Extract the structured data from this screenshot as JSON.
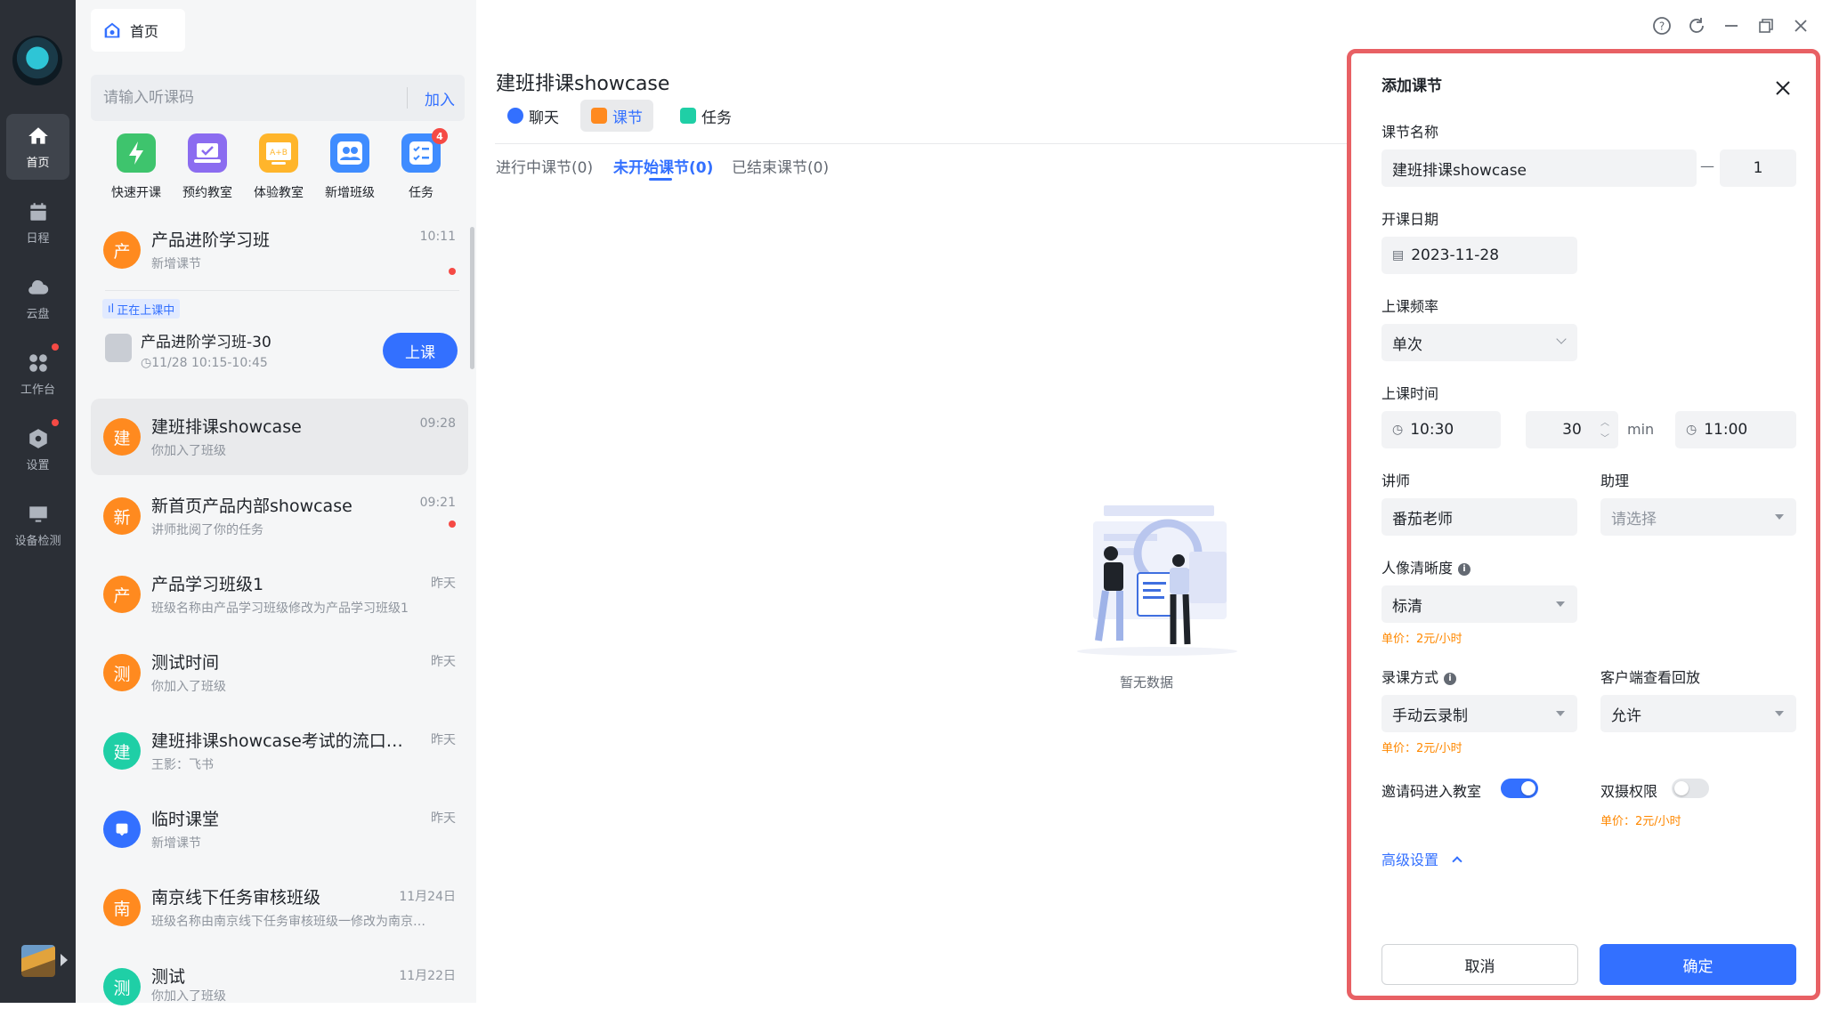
{
  "nav": {
    "items": [
      {
        "label": "首页",
        "icon": "home-icon"
      },
      {
        "label": "日程",
        "icon": "calendar-icon"
      },
      {
        "label": "云盘",
        "icon": "cloud-icon"
      },
      {
        "label": "工作台",
        "icon": "apps-icon"
      },
      {
        "label": "设置",
        "icon": "settings-icon"
      },
      {
        "label": "设备检测",
        "icon": "device-check-icon"
      }
    ]
  },
  "header": {
    "home_tab": "首页"
  },
  "join": {
    "placeholder": "请输入听课码",
    "button": "加入"
  },
  "quick_actions": [
    {
      "label": "快速开课",
      "color": "#3ec46d"
    },
    {
      "label": "预约教室",
      "color": "#8b6cf0"
    },
    {
      "label": "体验教室",
      "color": "#ffb52b"
    },
    {
      "label": "新增班级",
      "color": "#3f8cff"
    },
    {
      "label": "任务",
      "color": "#3f8cff",
      "badge": "4"
    }
  ],
  "conversations": [
    {
      "avatar": "产",
      "title": "产品进阶学习班",
      "subtitle": "新增课节",
      "time": "10:11",
      "unread": true,
      "color": "#ff8a1f"
    },
    {
      "avatar": "建",
      "title": "建班排课showcase",
      "subtitle": "你加入了班级",
      "time": "09:28",
      "unread": false,
      "color": "#ff8a1f"
    },
    {
      "avatar": "新",
      "title": "新首页产品内部showcase",
      "subtitle": "讲师批阅了你的任务",
      "time": "09:21",
      "unread": true,
      "color": "#ff8a1f"
    },
    {
      "avatar": "产",
      "title": "产品学习班级1",
      "subtitle": "班级名称由产品学习班级修改为产品学习班级1",
      "time": "昨天",
      "unread": false,
      "color": "#ff8a1f"
    },
    {
      "avatar": "测",
      "title": "测试时间",
      "subtitle": "你加入了班级",
      "time": "昨天",
      "unread": false,
      "color": "#ff8a1f"
    },
    {
      "avatar": "建",
      "title": "建班排课showcase考试的流口水…",
      "subtitle": "王影：飞书",
      "time": "昨天",
      "unread": false,
      "color": "#1fcfa6"
    },
    {
      "avatar": "",
      "title": "临时课堂",
      "subtitle": "新增课节",
      "time": "昨天",
      "unread": false,
      "color": "#3370ff"
    },
    {
      "avatar": "南",
      "title": "南京线下任务审核班级",
      "subtitle": "班级名称由南京线下任务审核班级一修改为南京…",
      "time": "11月24日",
      "unread": false,
      "color": "#ff8a1f"
    },
    {
      "avatar": "测",
      "title": "测试",
      "subtitle": "你加入了班级",
      "time": "11月22日",
      "unread": false,
      "color": "#1fcfa6"
    }
  ],
  "live": {
    "badge": "正在上课中",
    "title": "产品进阶学习班-30",
    "time": "11/28 10:15-10:45",
    "button": "上课"
  },
  "main": {
    "title": "建班排课showcase",
    "tabs": [
      "聊天",
      "课节",
      "任务"
    ],
    "status_tabs": [
      "进行中课节(0)",
      "未开始课节(0)",
      "已结束课节(0)"
    ],
    "empty_text": "暂无数据"
  },
  "dialog": {
    "title": "添加课节",
    "name_label": "课节名称",
    "name_value": "建班排课showcase",
    "dash": "—",
    "index_value": "1",
    "date_label": "开课日期",
    "date_value": "2023-11-28",
    "freq_label": "上课频率",
    "freq_value": "单次",
    "time_label": "上课时间",
    "start_time": "10:30",
    "duration": "30",
    "duration_unit": "min",
    "end_time": "11:00",
    "teacher_label": "讲师",
    "teacher_value": "番茄老师",
    "assistant_label": "助理",
    "assistant_placeholder": "请选择",
    "resolution_label": "人像清晰度",
    "resolution_value": "标清",
    "resolution_price": "单价：2元/小时",
    "record_label": "录课方式",
    "record_value": "手动云录制",
    "record_price": "单价：2元/小时",
    "replay_label": "客户端查看回放",
    "replay_value": "允许",
    "invite_label": "邀请码进入教室",
    "invite_on": true,
    "dual_label": "双摄权限",
    "dual_on": false,
    "dual_price": "单价：2元/小时",
    "advanced": "高级设置",
    "cancel": "取消",
    "confirm": "确定"
  }
}
